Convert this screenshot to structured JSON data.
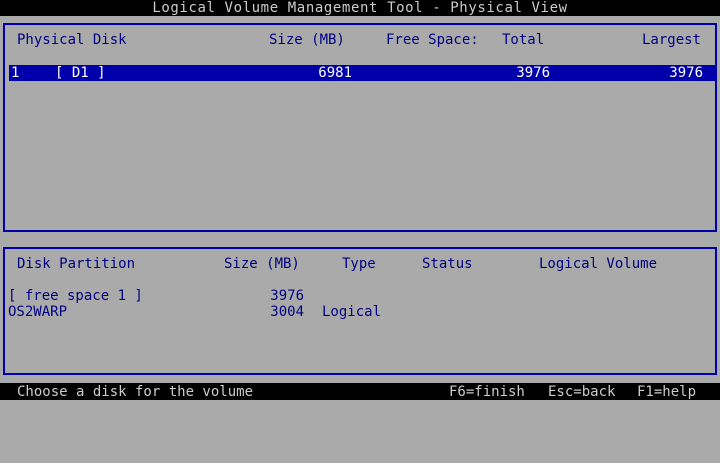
{
  "window": {
    "title": "Logical Volume Management Tool - Physical View"
  },
  "physical_disks": {
    "headers": {
      "disk": "Physical Disk",
      "size": "Size (MB)",
      "free_space": "Free Space:",
      "total": "Total",
      "largest": "Largest"
    },
    "rows": [
      {
        "number": "1",
        "name": "[ D1 ]",
        "size": "6981",
        "total": "3976",
        "largest": "3976",
        "selected": true
      }
    ]
  },
  "partitions": {
    "headers": {
      "partition": "Disk Partition",
      "size": "Size (MB)",
      "type": "Type",
      "status": "Status",
      "volume": "Logical Volume"
    },
    "rows": [
      {
        "name": "[ free space 1 ]",
        "size": "3976",
        "type": "",
        "status": "",
        "volume": ""
      },
      {
        "name": "OS2WARP",
        "size": "3004",
        "type": "Logical",
        "status": "",
        "volume": ""
      }
    ]
  },
  "status_bar": {
    "hint": "Choose a disk for the volume",
    "keys": {
      "f6": "F6=finish",
      "esc": "Esc=back",
      "f1": "F1=help"
    }
  },
  "colors": {
    "background": "#aaaaaa",
    "panel_border": "#0000aa",
    "text": "#000080",
    "selection_bg": "#0000aa",
    "selection_text": "#ffffff",
    "bar_bg": "#000000",
    "bar_text": "#cccccc"
  }
}
